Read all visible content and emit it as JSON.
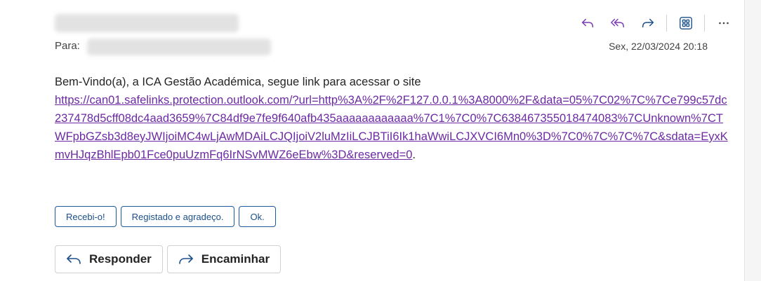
{
  "header": {
    "to_label": "Para:",
    "timestamp": "Sex, 22/03/2024 20:18"
  },
  "toolbar": {
    "icons": [
      "reply-icon",
      "reply-all-icon",
      "forward-icon",
      "apps-icon",
      "more-icon"
    ],
    "accent_color": "#7b3bb5"
  },
  "message": {
    "greeting": "Bem-Vindo(a), a ICA Gestão Académica, segue link para acessar o site",
    "link_text": "https://can01.safelinks.protection.outlook.com/?url=http%3A%2F%2F127.0.0.1%3A8000%2F&data=05%7C02%7C%7Ce799c57dc237478d5cff08dc4aad3659%7C84df9e7fe9f640afb435aaaaaaaaaaaa%7C1%7C0%7C638467355018474083%7CUnknown%7CTWFpbGZsb3d8eyJWIjoiMC4wLjAwMDAiLCJQIjoiV2luMzIiLCJBTiI6Ik1haWwiLCJXVCI6Mn0%3D%7C0%7C%7C%7C&sdata=EyxKmvHJqzBhlEpb01Fce0puUzmFq6IrNSvMWZ6eEbw%3D&reserved=0",
    "trailing": "."
  },
  "quick_replies": [
    "Recebi-o!",
    "Registado e agradeço.",
    "Ok."
  ],
  "buttons": {
    "reply": "Responder",
    "forward": "Encaminhar"
  }
}
